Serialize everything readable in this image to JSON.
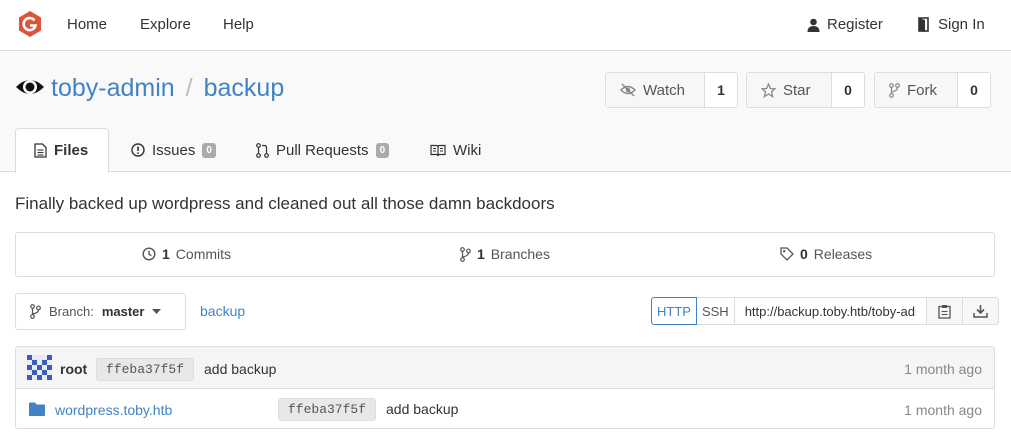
{
  "nav": {
    "home": "Home",
    "explore": "Explore",
    "help": "Help",
    "register": "Register",
    "sign_in": "Sign In"
  },
  "repo": {
    "owner": "toby-admin",
    "separator": "/",
    "name": "backup",
    "watch_label": "Watch",
    "watch_count": "1",
    "star_label": "Star",
    "star_count": "0",
    "fork_label": "Fork",
    "fork_count": "0",
    "description": "Finally backed up wordpress and cleaned out all those damn backdoors"
  },
  "tabs": [
    {
      "label": "Files",
      "badge": null
    },
    {
      "label": "Issues",
      "badge": "0"
    },
    {
      "label": "Pull Requests",
      "badge": "0"
    },
    {
      "label": "Wiki",
      "badge": null
    }
  ],
  "stats": {
    "commits_count": "1",
    "commits_label": "Commits",
    "branches_count": "1",
    "branches_label": "Branches",
    "releases_count": "0",
    "releases_label": "Releases"
  },
  "branch": {
    "prefix": "Branch:",
    "name": "master",
    "path": "backup"
  },
  "clone": {
    "http": "HTTP",
    "ssh": "SSH",
    "url": "http://backup.toby.htb/toby-admin/backup.git"
  },
  "latest_commit": {
    "author": "root",
    "sha": "ffeba37f5f",
    "message": "add backup",
    "age": "1 month ago"
  },
  "files": [
    {
      "name": "wordpress.toby.htb",
      "sha": "ffeba37f5f",
      "message": "add backup",
      "age": "1 month ago"
    }
  ],
  "colors": {
    "link": "#4183c4",
    "logo": "#d9553b",
    "badge": "#aaaaaa"
  }
}
